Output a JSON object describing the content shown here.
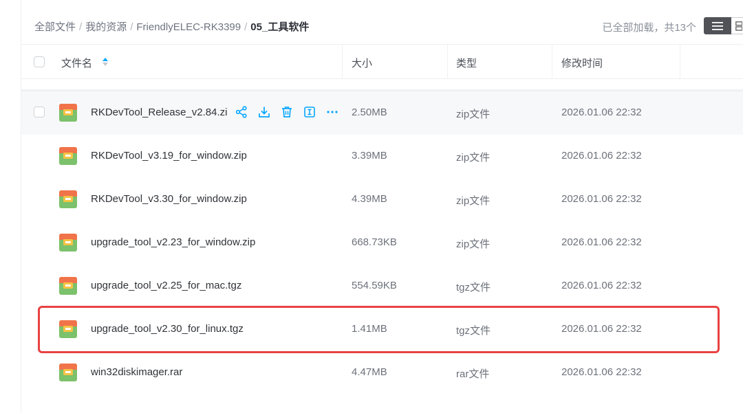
{
  "breadcrumb": {
    "items": [
      "全部文件",
      "我的资源",
      "FriendlyELEC-RK3399"
    ],
    "separator": "/",
    "current": "05_工具软件"
  },
  "status_text": "已全部加载，共13个",
  "columns": {
    "name": "文件名",
    "size": "大小",
    "type": "类型",
    "modified": "修改时间"
  },
  "files": [
    {
      "name": "RKDevTool_Release_v2.84.zi",
      "size": "2.50MB",
      "type": "zip文件",
      "modified": "2026.01.06 22:32"
    },
    {
      "name": "RKDevTool_v3.19_for_window.zip",
      "size": "3.39MB",
      "type": "zip文件",
      "modified": "2026.01.06 22:32"
    },
    {
      "name": "RKDevTool_v3.30_for_window.zip",
      "size": "4.39MB",
      "type": "zip文件",
      "modified": "2026.01.06 22:32"
    },
    {
      "name": "upgrade_tool_v2.23_for_window.zip",
      "size": "668.73KB",
      "type": "zip文件",
      "modified": "2026.01.06 22:32"
    },
    {
      "name": "upgrade_tool_v2.25_for_mac.tgz",
      "size": "554.59KB",
      "type": "tgz文件",
      "modified": "2026.01.06 22:32"
    },
    {
      "name": "upgrade_tool_v2.30_for_linux.tgz",
      "size": "1.41MB",
      "type": "tgz文件",
      "modified": "2026.01.06 22:32"
    },
    {
      "name": "win32diskimager.rar",
      "size": "4.47MB",
      "type": "rar文件",
      "modified": "2026.01.06 22:32"
    }
  ],
  "row_action_icons": [
    "share-icon",
    "download-icon",
    "delete-icon",
    "rename-icon",
    "more-icon"
  ],
  "colors": {
    "accent": "#06a7ff",
    "highlight": "#e84141",
    "archive_orange": "#f0734a",
    "archive_green": "#7cc16b",
    "archive_yellow": "#f6c343"
  }
}
